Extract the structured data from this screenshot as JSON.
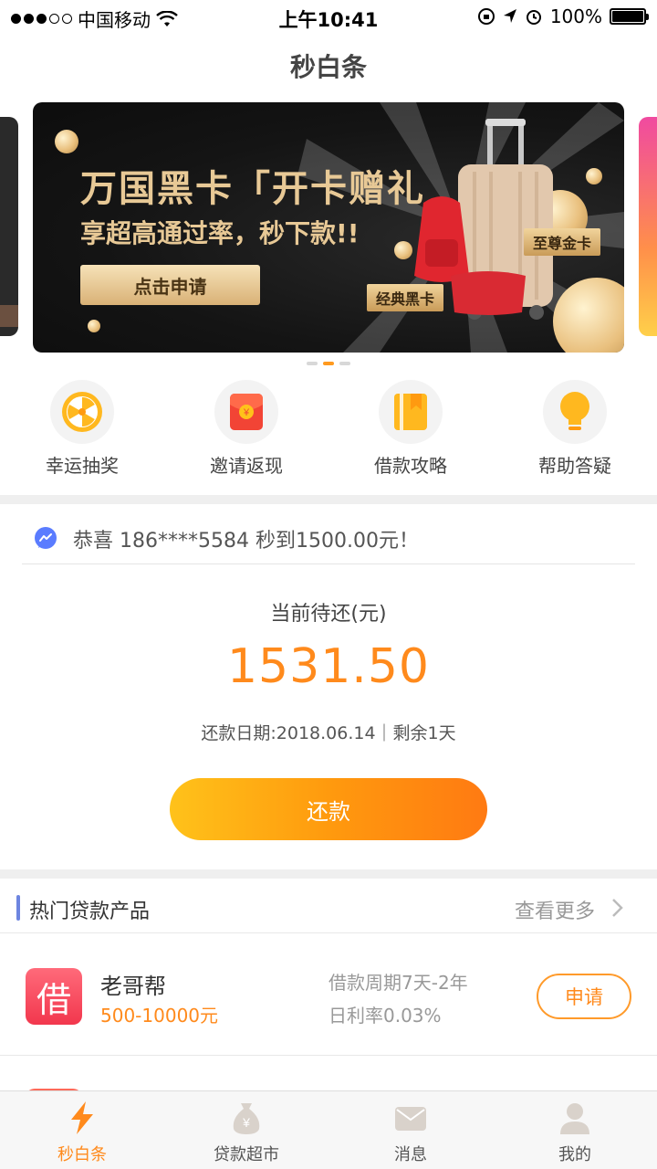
{
  "status_bar": {
    "carrier": "中国移动",
    "time": "上午10:41",
    "battery": "100%"
  },
  "nav": {
    "title": "秒白条"
  },
  "banner": {
    "title": "万国黑卡「开卡赠礼",
    "subtitle": "享超高通过率，秒下款!!",
    "button": "点击申请",
    "tag_black": "经典黑卡",
    "tag_gold": "至尊金卡",
    "current_page": 2,
    "page_count": 3
  },
  "quick_links": [
    {
      "label": "幸运抽奖",
      "icon": "lucky-wheel-icon"
    },
    {
      "label": "邀请返现",
      "icon": "red-envelope-icon"
    },
    {
      "label": "借款攻略",
      "icon": "book-icon"
    },
    {
      "label": "帮助答疑",
      "icon": "lightbulb-icon"
    }
  ],
  "notice": {
    "text": "恭喜 186****5584 秒到1500.00元！"
  },
  "repayment": {
    "label": "当前待还(元)",
    "amount": "1531.50",
    "due_text": "还款日期:2018.06.14｜剩余1天",
    "button": "还款"
  },
  "hot_products": {
    "title": "热门贷款产品",
    "more": "查看更多",
    "items": [
      {
        "logo_char": "借",
        "name": "老哥帮",
        "range": "500-10000元",
        "term": "借款周期7天-2年",
        "rate": "日利率0.03%",
        "button": "申请"
      }
    ]
  },
  "tabbar": {
    "active": 0,
    "tabs": [
      {
        "label": "秒白条",
        "icon": "lightning-icon"
      },
      {
        "label": "贷款超市",
        "icon": "money-bag-icon"
      },
      {
        "label": "消息",
        "icon": "message-icon"
      },
      {
        "label": "我的",
        "icon": "user-icon"
      }
    ]
  },
  "colors": {
    "accent": "#ff8a1c",
    "gold": "#e8c996",
    "hot_bar": "#6d85e0"
  }
}
